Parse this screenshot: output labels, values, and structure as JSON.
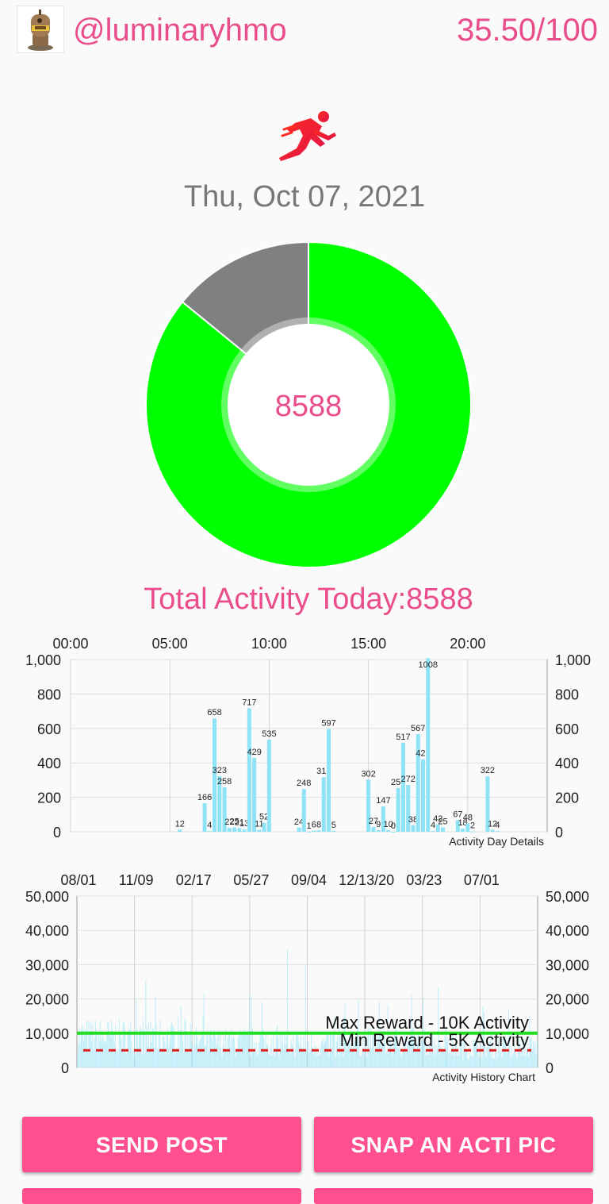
{
  "header": {
    "username": "@luminaryhmo",
    "score": "35.50/100",
    "avatar_icon": "robot-avatar-icon"
  },
  "activity_icon": "runner-icon",
  "date": "Thu, Oct 07, 2021",
  "colors": {
    "accent": "#e94e8a",
    "button": "#ff4f8e",
    "donut_progress": "#00ff00",
    "donut_remaining": "#808080",
    "bar": "#8fe3f7",
    "max_line": "#22dd22",
    "min_line": "#dd2222"
  },
  "donut": {
    "center_value": "8588",
    "value": 8588,
    "goal": 10000
  },
  "total_label": "Total Activity Today:8588",
  "chart_data": [
    {
      "type": "bar",
      "caption": "Activity Day Details",
      "x_tick_labels": [
        "00:00",
        "05:00",
        "10:00",
        "15:00",
        "20:00"
      ],
      "ylim": [
        0,
        1000
      ],
      "y_ticks": [
        "0",
        "200",
        "400",
        "600",
        "800",
        "1,000"
      ],
      "grid": true,
      "x_unit": "hour",
      "bars": [
        {
          "x": 5.5,
          "value": 12,
          "label": "12"
        },
        {
          "x": 6.75,
          "value": 166,
          "label": "166"
        },
        {
          "x": 7.0,
          "value": 4,
          "label": "4"
        },
        {
          "x": 7.25,
          "value": 658,
          "label": "658"
        },
        {
          "x": 7.5,
          "value": 323,
          "label": "323"
        },
        {
          "x": 7.75,
          "value": 258,
          "label": "258"
        },
        {
          "x": 8.0,
          "value": 22,
          "label": "22"
        },
        {
          "x": 8.25,
          "value": 25,
          "label": "25"
        },
        {
          "x": 8.5,
          "value": 21,
          "label": "21"
        },
        {
          "x": 8.75,
          "value": 13,
          "label": "13"
        },
        {
          "x": 9.0,
          "value": 717,
          "label": "717"
        },
        {
          "x": 9.25,
          "value": 429,
          "label": "429"
        },
        {
          "x": 9.5,
          "value": 11,
          "label": "11"
        },
        {
          "x": 9.75,
          "value": 52,
          "label": "52"
        },
        {
          "x": 10.0,
          "value": 535,
          "label": "535"
        },
        {
          "x": 11.5,
          "value": 24,
          "label": "24"
        },
        {
          "x": 11.75,
          "value": 248,
          "label": "248"
        },
        {
          "x": 12.0,
          "value": 1,
          "label": "1"
        },
        {
          "x": 12.25,
          "value": 6,
          "label": "6"
        },
        {
          "x": 12.5,
          "value": 8,
          "label": "8"
        },
        {
          "x": 12.75,
          "value": 317,
          "label": "317"
        },
        {
          "x": 13.0,
          "value": 597,
          "label": "597"
        },
        {
          "x": 13.25,
          "value": 5,
          "label": "5"
        },
        {
          "x": 15.0,
          "value": 302,
          "label": "302"
        },
        {
          "x": 15.25,
          "value": 27,
          "label": "27"
        },
        {
          "x": 15.5,
          "value": 9,
          "label": "9"
        },
        {
          "x": 15.75,
          "value": 147,
          "label": "147"
        },
        {
          "x": 16.0,
          "value": 10,
          "label": "10"
        },
        {
          "x": 16.25,
          "value": 0,
          "label": "0"
        },
        {
          "x": 16.5,
          "value": 254,
          "label": "254"
        },
        {
          "x": 16.75,
          "value": 517,
          "label": "517"
        },
        {
          "x": 17.0,
          "value": 272,
          "label": "272"
        },
        {
          "x": 17.25,
          "value": 38,
          "label": "38"
        },
        {
          "x": 17.5,
          "value": 567,
          "label": "567"
        },
        {
          "x": 17.75,
          "value": 421,
          "label": "421"
        },
        {
          "x": 18.0,
          "value": 1008,
          "label": "1008"
        },
        {
          "x": 18.25,
          "value": 4,
          "label": "4"
        },
        {
          "x": 18.5,
          "value": 42,
          "label": "42"
        },
        {
          "x": 18.75,
          "value": 25,
          "label": "25"
        },
        {
          "x": 19.5,
          "value": 67,
          "label": "67"
        },
        {
          "x": 19.75,
          "value": 18,
          "label": "18"
        },
        {
          "x": 20.0,
          "value": 48,
          "label": "48"
        },
        {
          "x": 20.25,
          "value": 2,
          "label": "2"
        },
        {
          "x": 21.0,
          "value": 322,
          "label": "322"
        },
        {
          "x": 21.25,
          "value": 12,
          "label": "12"
        },
        {
          "x": 21.5,
          "value": 4,
          "label": "4"
        }
      ]
    },
    {
      "type": "bar",
      "caption": "Activity History Chart",
      "x_tick_labels": [
        "08/01",
        "11/09",
        "02/17",
        "05/27",
        "09/04",
        "12/13/20",
        "03/23",
        "07/01"
      ],
      "ylim": [
        0,
        50000
      ],
      "y_ticks": [
        "0",
        "10,000",
        "20,000",
        "30,000",
        "40,000",
        "50,000"
      ],
      "grid": true,
      "reference_lines": [
        {
          "name": "Max Reward - 10K Activity",
          "value": 10000,
          "style": "solid",
          "color": "#22dd22"
        },
        {
          "name": "Min Reward - 5K Activity",
          "value": 5000,
          "style": "dashed",
          "color": "#dd2222"
        }
      ],
      "density_bands": [
        {
          "x_start": 0,
          "x_end": 0.25,
          "typical": 12000,
          "peak": 26000
        },
        {
          "x_start": 0.25,
          "x_end": 0.45,
          "typical": 10000,
          "peak": 22000
        },
        {
          "x_start": 0.45,
          "x_end": 0.55,
          "typical": 9000,
          "peak": 46000
        },
        {
          "x_start": 0.55,
          "x_end": 0.8,
          "typical": 10000,
          "peak": 25000
        },
        {
          "x_start": 0.8,
          "x_end": 1.0,
          "typical": 8000,
          "peak": 19000
        }
      ]
    }
  ],
  "buttons": {
    "send_post": "SEND POST",
    "snap_pic": "SNAP AN ACTI PIC"
  }
}
